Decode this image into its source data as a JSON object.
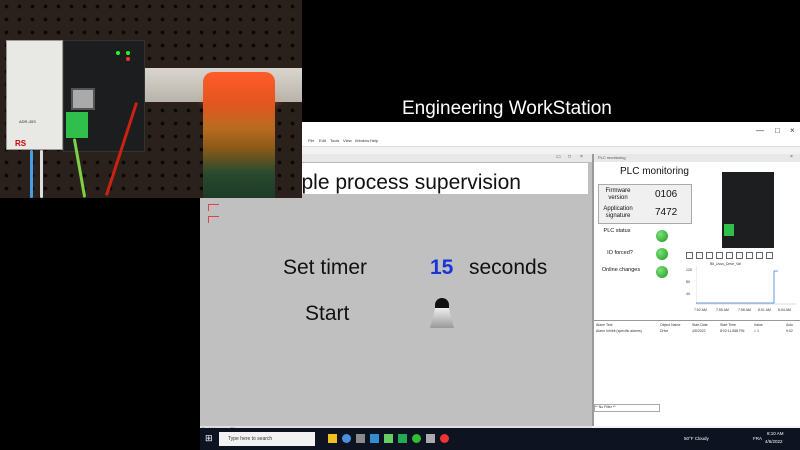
{
  "overlay_title": "Engineering WorkStation",
  "camera": {
    "psu_brand": "RS",
    "psu_label": "ADR-45S",
    "tower_light_color": "#ff5b2a"
  },
  "menubar": {
    "items": [
      "File",
      "Edit",
      "Tools",
      "View",
      "Window",
      "Help"
    ],
    "window_controls": {
      "minimize": "—",
      "maximize": "□",
      "close": "×"
    }
  },
  "supervision": {
    "title": "mple process supervision",
    "set_timer_label": "Set timer",
    "timer_value": "15",
    "seconds_label": "seconds",
    "start_label": "Start",
    "status_text": "For Help, press F1",
    "accent_color": "#1a35d6"
  },
  "monitor": {
    "window_title": "PLC monitoring",
    "title": "PLC monitoring",
    "firmware_label": "Firmware version",
    "firmware_value": "0106",
    "app_sig_label": "Application signature",
    "app_sig_value": "7472",
    "plc_status_label": "PLC status",
    "io_forced_label": "IO forced?",
    "online_changes_label": "Online changes",
    "status_color": "#1a9b1a",
    "chart": {
      "y_ticks": [
        "120",
        "80",
        "40"
      ],
      "x_ticks": [
        "7:52 AM",
        "7:55 AM",
        "7:58 AM",
        "8:01 AM",
        "8:04 AM"
      ],
      "legend": "Bit_Uvus_Drive_Val"
    },
    "alarm_columns": [
      "Alarm Text",
      "Object Name",
      "Start Date",
      "Start Time",
      "Value",
      "Actu"
    ],
    "alarm_row": [
      "Alarm Inhibit (specific alarms)",
      "Drive",
      "4/5/2022",
      "8:02:11.868 PM",
      "= 1",
      "9:02"
    ],
    "filter": "** No Filter **"
  },
  "taskbar": {
    "search_placeholder": "Type here to search",
    "weather": "50°F Cloudy",
    "lang": "FRA",
    "time": "8:10 AM",
    "date": "4/6/2022"
  }
}
